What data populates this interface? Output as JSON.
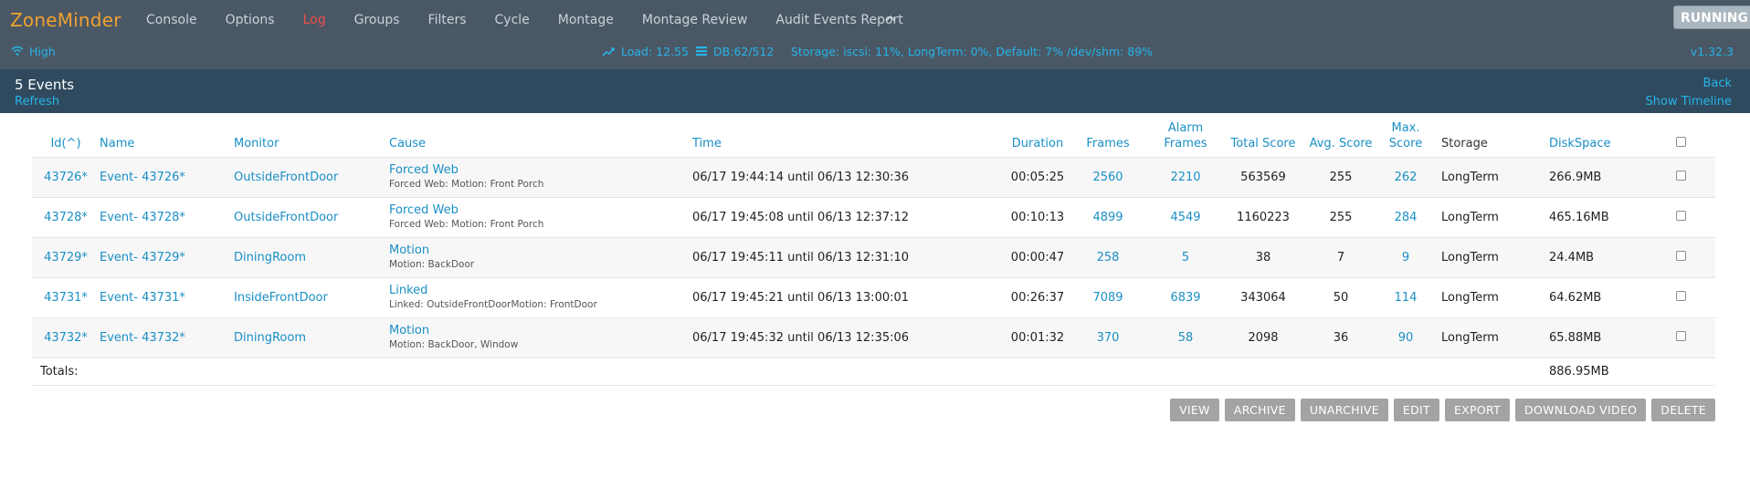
{
  "brand": "ZoneMinder",
  "nav": {
    "items": [
      {
        "label": "Console",
        "active": false
      },
      {
        "label": "Options",
        "active": false
      },
      {
        "label": "Log",
        "active": true
      },
      {
        "label": "Groups",
        "active": false
      },
      {
        "label": "Filters",
        "active": false
      },
      {
        "label": "Cycle",
        "active": false
      },
      {
        "label": "Montage",
        "active": false
      },
      {
        "label": "Montage Review",
        "active": false
      },
      {
        "label": "Audit Events Report",
        "active": false
      }
    ],
    "running_label": "RUNNING"
  },
  "status": {
    "bandwidth": "High",
    "load": "Load: 12.55",
    "db": "DB:62/512",
    "storage": "Storage: iscsi: 11%, LongTerm: 0%, Default: 7% /dev/shm: 89%",
    "version": "v1.32.3"
  },
  "header": {
    "title": "5 Events",
    "refresh": "Refresh",
    "back": "Back",
    "timeline": "Show Timeline"
  },
  "columns": {
    "id": "Id(^)",
    "name": "Name",
    "monitor": "Monitor",
    "cause": "Cause",
    "time": "Time",
    "duration": "Duration",
    "frames": "Frames",
    "alarm_frames": "Alarm Frames",
    "total_score": "Total Score",
    "avg_score": "Avg. Score",
    "max_score": "Max. Score",
    "storage": "Storage",
    "diskspace": "DiskSpace"
  },
  "events": [
    {
      "id": "43726*",
      "name": "Event- 43726*",
      "monitor": "OutsideFrontDoor",
      "cause": "Forced Web",
      "notes": "Forced Web: Motion: Front Porch",
      "time": "06/17 19:44:14 until 06/13 12:30:36",
      "duration": "00:05:25",
      "frames": "2560",
      "alarm_frames": "2210",
      "total_score": "563569",
      "avg_score": "255",
      "max_score": "262",
      "storage": "LongTerm",
      "diskspace": "266.9MB"
    },
    {
      "id": "43728*",
      "name": "Event- 43728*",
      "monitor": "OutsideFrontDoor",
      "cause": "Forced Web",
      "notes": "Forced Web: Motion: Front Porch",
      "time": "06/17 19:45:08 until 06/13 12:37:12",
      "duration": "00:10:13",
      "frames": "4899",
      "alarm_frames": "4549",
      "total_score": "1160223",
      "avg_score": "255",
      "max_score": "284",
      "storage": "LongTerm",
      "diskspace": "465.16MB"
    },
    {
      "id": "43729*",
      "name": "Event- 43729*",
      "monitor": "DiningRoom",
      "cause": "Motion",
      "notes": "Motion: BackDoor",
      "time": "06/17 19:45:11 until 06/13 12:31:10",
      "duration": "00:00:47",
      "frames": "258",
      "alarm_frames": "5",
      "total_score": "38",
      "avg_score": "7",
      "max_score": "9",
      "storage": "LongTerm",
      "diskspace": "24.4MB"
    },
    {
      "id": "43731*",
      "name": "Event- 43731*",
      "monitor": "InsideFrontDoor",
      "cause": "Linked",
      "notes": "Linked: OutsideFrontDoorMotion: FrontDoor",
      "time": "06/17 19:45:21 until 06/13 13:00:01",
      "duration": "00:26:37",
      "frames": "7089",
      "alarm_frames": "6839",
      "total_score": "343064",
      "avg_score": "50",
      "max_score": "114",
      "storage": "LongTerm",
      "diskspace": "64.62MB"
    },
    {
      "id": "43732*",
      "name": "Event- 43732*",
      "monitor": "DiningRoom",
      "cause": "Motion",
      "notes": "Motion: BackDoor, Window",
      "time": "06/17 19:45:32 until 06/13 12:35:06",
      "duration": "00:01:32",
      "frames": "370",
      "alarm_frames": "58",
      "total_score": "2098",
      "avg_score": "36",
      "max_score": "90",
      "storage": "LongTerm",
      "diskspace": "65.88MB"
    }
  ],
  "totals": {
    "label": "Totals:",
    "diskspace": "886.95MB"
  },
  "actions": [
    "VIEW",
    "ARCHIVE",
    "UNARCHIVE",
    "EDIT",
    "EXPORT",
    "DOWNLOAD VIDEO",
    "DELETE"
  ],
  "icons": {
    "bandwidth": "wifi-icon",
    "load": "trend-up-icon",
    "db": "database-icon",
    "collapse": "chevron-up-icon"
  },
  "colors": {
    "nav_bg": "#4a5865",
    "header_bg": "#2f4a5e",
    "brand": "#f0a030",
    "active": "#ef4b4b",
    "link": "#1a8fc6",
    "status": "#27b3e8",
    "button": "#a3a3a3"
  }
}
